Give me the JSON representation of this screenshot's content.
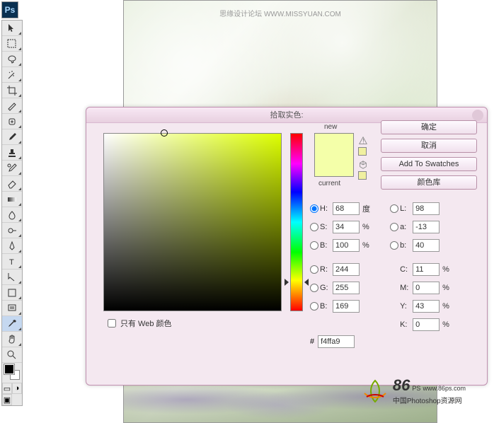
{
  "app": {
    "logo": "Ps"
  },
  "canvas": {
    "watermark": "思缘设计论坛 WWW.MISSYUAN.COM"
  },
  "dialog": {
    "title": "拾取实色:",
    "labels": {
      "new": "new",
      "current": "current",
      "web_only": "只有 Web 颜色",
      "hex_prefix": "#"
    },
    "buttons": {
      "ok": "确定",
      "cancel": "取消",
      "add_swatch": "Add To Swatches",
      "color_lib": "颜色库"
    },
    "hsb": {
      "h_label": "H:",
      "h": "68",
      "h_unit": "度",
      "s_label": "S:",
      "s": "34",
      "s_unit": "%",
      "b_label": "B:",
      "b": "100",
      "b_unit": "%"
    },
    "rgb": {
      "r_label": "R:",
      "r": "244",
      "g_label": "G:",
      "g": "255",
      "bl_label": "B:",
      "bl": "169"
    },
    "lab": {
      "l_label": "L:",
      "l": "98",
      "a_label": "a:",
      "a": "-13",
      "lb_label": "b:",
      "lb": "40"
    },
    "cmyk": {
      "c_label": "C:",
      "c": "11",
      "c_unit": "%",
      "m_label": "M:",
      "m": "0",
      "m_unit": "%",
      "y_label": "Y:",
      "y": "43",
      "y_unit": "%",
      "k_label": "K:",
      "k": "0",
      "k_unit": "%"
    },
    "hex": "f4ffa9"
  },
  "watermark86": {
    "big": "86",
    "suffix": "PS",
    "url": "www.86ps.com",
    "sub": "中国Photoshop资源网"
  }
}
